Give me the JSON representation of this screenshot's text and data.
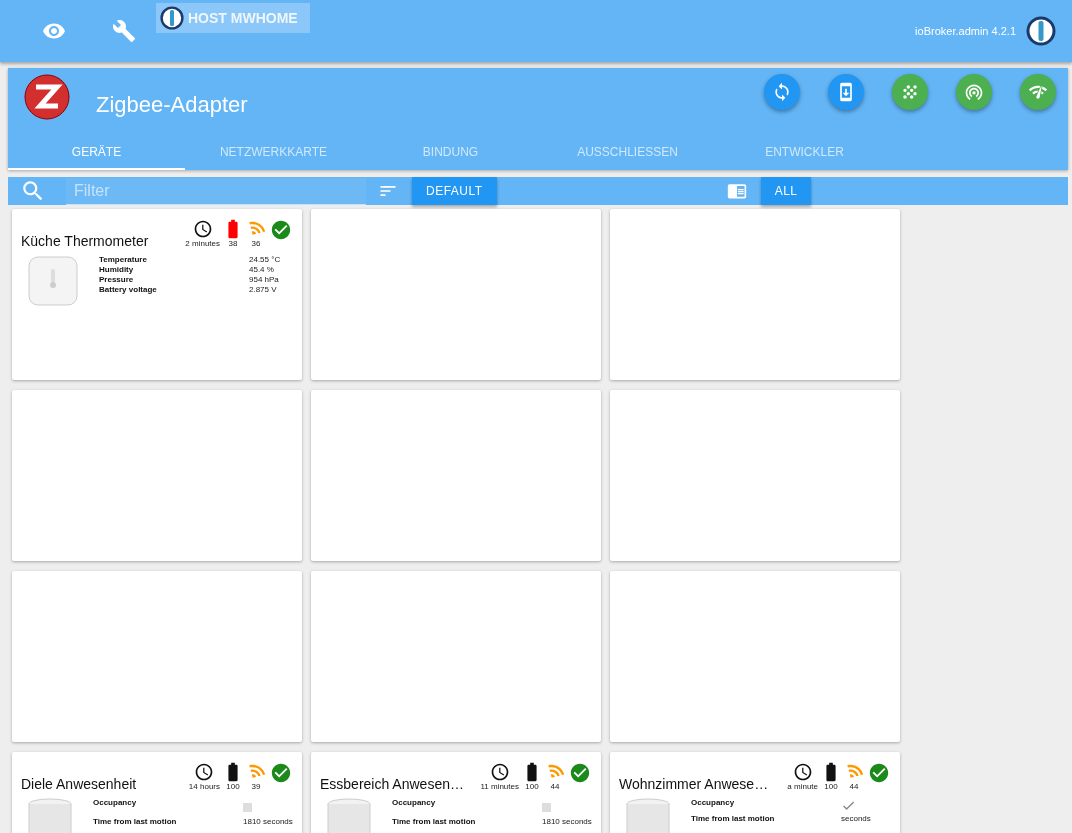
{
  "top_bar": {
    "host": "HOST MWHOME",
    "version": "ioBroker.admin 4.2.1"
  },
  "adapter": {
    "title": "Zigbee-Adapter"
  },
  "tabs": [
    {
      "label": "GERÄTE",
      "selected": true
    },
    {
      "label": "NETZWERKKARTE",
      "selected": false
    },
    {
      "label": "BINDUNG",
      "selected": false
    },
    {
      "label": "AUSSCHLIESSEN",
      "selected": false
    },
    {
      "label": "ENTWICKLER",
      "selected": false
    }
  ],
  "actions": [
    {
      "kind": "refresh",
      "color": "#2196f3"
    },
    {
      "kind": "download",
      "color": "#2196f3"
    },
    {
      "kind": "dots",
      "color": "#4caf50"
    },
    {
      "kind": "broadcast",
      "color": "#4caf50"
    },
    {
      "kind": "signal",
      "color": "#4caf50"
    }
  ],
  "filter_bar": {
    "placeholder": "Filter",
    "sort_button": "DEFAULT",
    "view_button": "ALL"
  },
  "cards": [
    {
      "kind": "thermometer",
      "name": "Küche Thermometer",
      "last_seen": "2 minutes",
      "battery": "38",
      "battery_low": true,
      "link": "36",
      "states": [
        {
          "kind": "text",
          "label": "Temperature",
          "value": "24.55 °C"
        },
        {
          "kind": "text",
          "label": "Humidity",
          "value": "45.4 %"
        },
        {
          "kind": "text",
          "label": "Pressure",
          "value": "954 hPa"
        },
        {
          "kind": "text",
          "label": "Battery voltage",
          "value": "2.875 V"
        }
      ]
    },
    {
      "kind": "blank"
    },
    {
      "kind": "blank"
    },
    {
      "kind": "blank"
    },
    {
      "kind": "blank"
    },
    {
      "kind": "blank"
    },
    {
      "kind": "blank"
    },
    {
      "kind": "blank"
    },
    {
      "kind": "blank"
    },
    {
      "kind": "motion",
      "name": "Diele Anwesenheit",
      "last_seen": "14 hours",
      "battery": "100",
      "battery_low": false,
      "link": "39",
      "states": [
        {
          "kind": "check",
          "label": "Occupancy",
          "checked": false
        },
        {
          "kind": "text",
          "label": "Time from last motion",
          "value": "1810 seconds"
        }
      ]
    },
    {
      "kind": "motion",
      "name": "Essbereich Anwesen…",
      "last_seen": "11 minutes",
      "battery": "100",
      "battery_low": false,
      "link": "44",
      "states": [
        {
          "kind": "check",
          "label": "Occupancy",
          "checked": false
        },
        {
          "kind": "text",
          "label": "Time from last motion",
          "value": "1810 seconds"
        }
      ]
    },
    {
      "kind": "motion",
      "name": "Wohnzimmer Anwese…",
      "last_seen": "a minute",
      "battery": "100",
      "battery_low": false,
      "link": "44",
      "states": [
        {
          "kind": "check",
          "label": "Occupancy",
          "checked": true
        },
        {
          "kind": "text",
          "label": "Time from last motion",
          "value": "seconds"
        }
      ]
    }
  ]
}
